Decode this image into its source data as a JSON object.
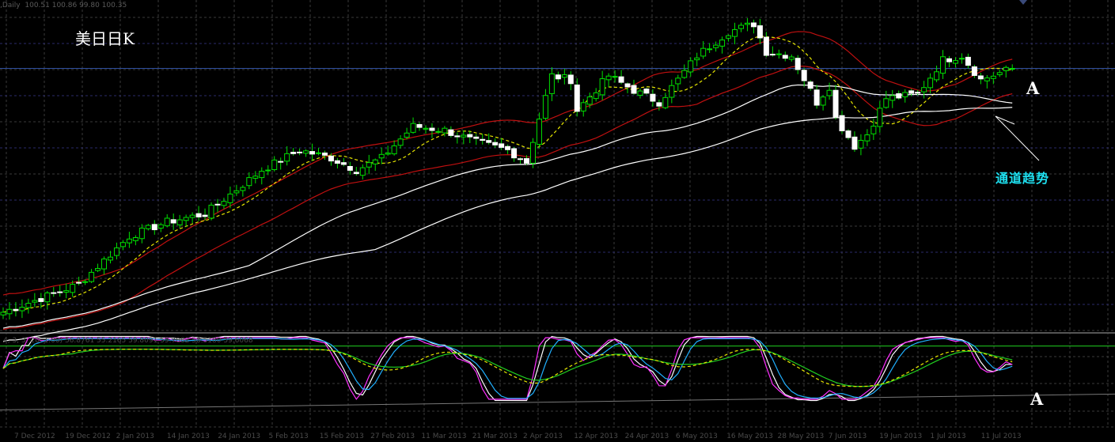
{
  "header": {
    "symbol_period": ",Daily",
    "ohlc": "100.51 100.86 99.80 100.35"
  },
  "annotations": {
    "title": "美日日K",
    "marker_main": "A",
    "marker_osc": "A",
    "channel_label": "通道趋势"
  },
  "indicator": {
    "params": "4, 3, 3, 20, 1.00)",
    "values": "56.8761 55.2165 59.8091 59.7082 58.5180 59.6068"
  },
  "colors": {
    "bull": "#00e000",
    "bear": "#ffffff",
    "band": "#c01010",
    "ma_dash": "#e8e800",
    "ma_slow": "#ffffff",
    "osc_white": "#ffffff",
    "osc_magenta": "#ff30ff",
    "osc_cyan": "#20b0ff",
    "osc_yellow": "#e8e800",
    "osc_green": "#20d020",
    "grid": "#3a3a3a",
    "grid_blue": "#2a2a6a",
    "price_line": "#3050a0"
  },
  "chart_data": {
    "type": "candlestick",
    "title": "USDJPY Daily",
    "x_tick_labels": [
      "7 Dec 2012",
      "19 Dec 2012",
      "2 Jan 2013",
      "14 Jan 2013",
      "24 Jan 2013",
      "5 Feb 2013",
      "15 Feb 2013",
      "27 Feb 2013",
      "11 Mar 2013",
      "21 Mar 2013",
      "2 Apr 2013",
      "12 Apr 2013",
      "24 Apr 2013",
      "6 May 2013",
      "16 May 2013",
      "28 May 2013",
      "7 Jun 2013",
      "19 Jun 2013",
      "1 Jul 2013",
      "11 Jul 2013"
    ],
    "bar_count": 161,
    "ylim": [
      80.5,
      105.5
    ],
    "close_keypoints": [
      [
        0,
        82.0
      ],
      [
        12,
        84.1
      ],
      [
        20,
        87.7
      ],
      [
        26,
        88.8
      ],
      [
        32,
        89.4
      ],
      [
        41,
        92.7
      ],
      [
        47,
        94.2
      ],
      [
        52,
        93.6
      ],
      [
        56,
        92.7
      ],
      [
        60,
        93.6
      ],
      [
        65,
        96.0
      ],
      [
        70,
        95.7
      ],
      [
        75,
        94.8
      ],
      [
        80,
        94.2
      ],
      [
        83,
        93.3
      ],
      [
        85,
        96.6
      ],
      [
        87,
        99.8
      ],
      [
        90,
        99.5
      ],
      [
        91,
        97.2
      ],
      [
        96,
        99.8
      ],
      [
        100,
        98.7
      ],
      [
        104,
        97.8
      ],
      [
        107,
        99.5
      ],
      [
        110,
        101.3
      ],
      [
        115,
        103.1
      ],
      [
        119,
        103.7
      ],
      [
        121,
        101.6
      ],
      [
        125,
        101.3
      ],
      [
        129,
        97.8
      ],
      [
        131,
        99.0
      ],
      [
        132,
        96.6
      ],
      [
        135,
        94.5
      ],
      [
        137,
        95.4
      ],
      [
        140,
        98.1
      ],
      [
        145,
        98.4
      ],
      [
        149,
        101.0
      ],
      [
        152,
        101.3
      ],
      [
        155,
        99.5
      ],
      [
        160,
        100.35
      ]
    ],
    "last_close": 100.35,
    "oscillator_ylim": [
      0,
      100
    ],
    "oscillator_levels": [
      80,
      20
    ]
  }
}
